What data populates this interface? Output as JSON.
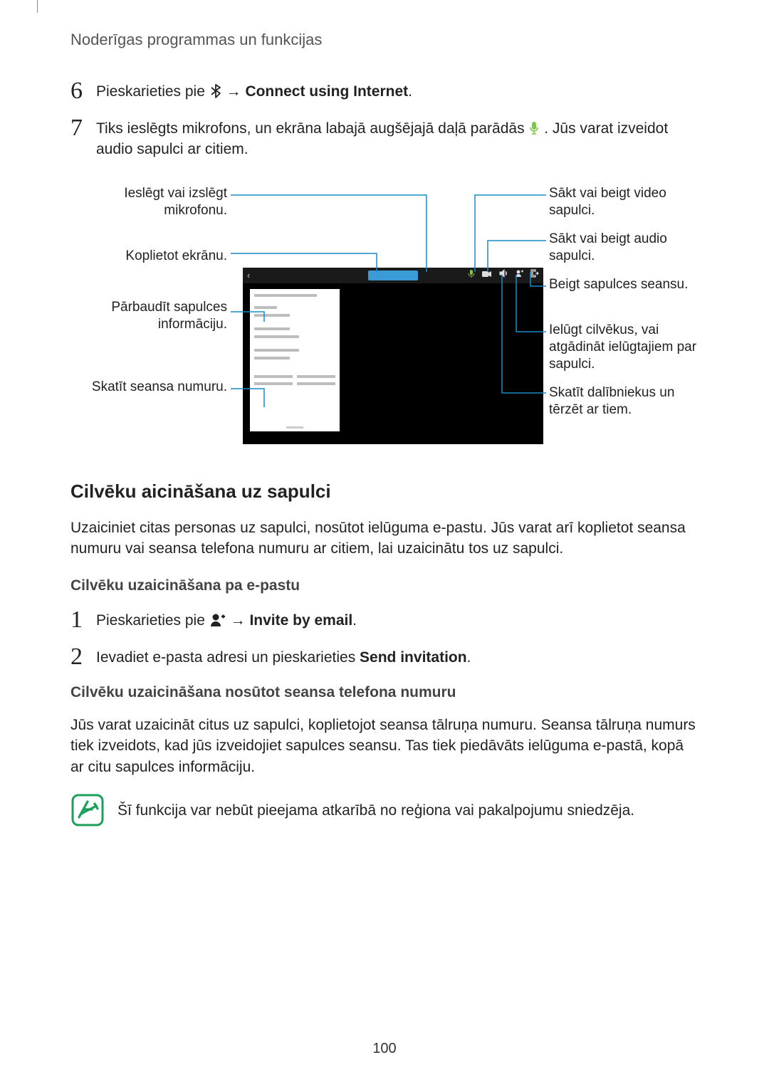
{
  "header": "Noderīgas programmas un funkcijas",
  "steps_a": [
    {
      "num": "6",
      "pre": "Pieskarieties pie ",
      "post_arrow": " → ",
      "bold": "Connect using Internet",
      "suffix": "."
    },
    {
      "num": "7",
      "pre": "Tiks ieslēgts mikrofons, un ekrāna labajā augšējajā daļā parādās ",
      "post": ". Jūs varat izveidot audio sapulci ar citiem."
    }
  ],
  "callouts_left": [
    "Ieslēgt vai izslēgt mikrofonu.",
    "Koplietot ekrānu.",
    "Pārbaudīt sapulces informāciju.",
    "Skatīt seansa numuru."
  ],
  "callouts_right": [
    "Sākt vai beigt video sapulci.",
    "Sākt vai beigt audio sapulci.",
    "Beigt sapulces seansu.",
    "Ielūgt cilvēkus, vai atgādināt ielūgtajiem par sapulci.",
    "Skatīt dalībniekus un tērzēt ar tiem."
  ],
  "section": {
    "title": "Cilvēku aicināšana uz sapulci",
    "para": "Uzaiciniet citas personas uz sapulci, nosūtot ielūguma e-pastu. Jūs varat arī koplietot seansa numuru vai seansa telefona numuru ar citiem, lai uzaicinātu tos uz sapulci.",
    "sub1_title": "Cilvēku uzaicināšana pa e-pastu",
    "sub1_step1_pre": "Pieskarieties pie ",
    "sub1_step1_arrow": " → ",
    "sub1_step1_bold": "Invite by email",
    "sub1_step1_suffix": ".",
    "sub1_step2_pre": "Ievadiet e-pasta adresi un pieskarieties ",
    "sub1_step2_bold": "Send invitation",
    "sub1_step2_suffix": ".",
    "sub2_title": "Cilvēku uzaicināšana nosūtot seansa telefona numuru",
    "sub2_para": "Jūs varat uzaicināt citus uz sapulci, koplietojot seansa tālruņa numuru. Seansa tālruņa numurs tiek izveidots, kad jūs izveidojiet sapulces seansu. Tas tiek piedāvāts ielūguma e-pastā, kopā ar citu sapulces informāciju.",
    "note": "Šī funkcija var nebūt pieejama atkarībā no reģiona vai pakalpojumu sniedzēja."
  },
  "steps_b": {
    "n1": "1",
    "n2": "2"
  },
  "page_number": "100"
}
